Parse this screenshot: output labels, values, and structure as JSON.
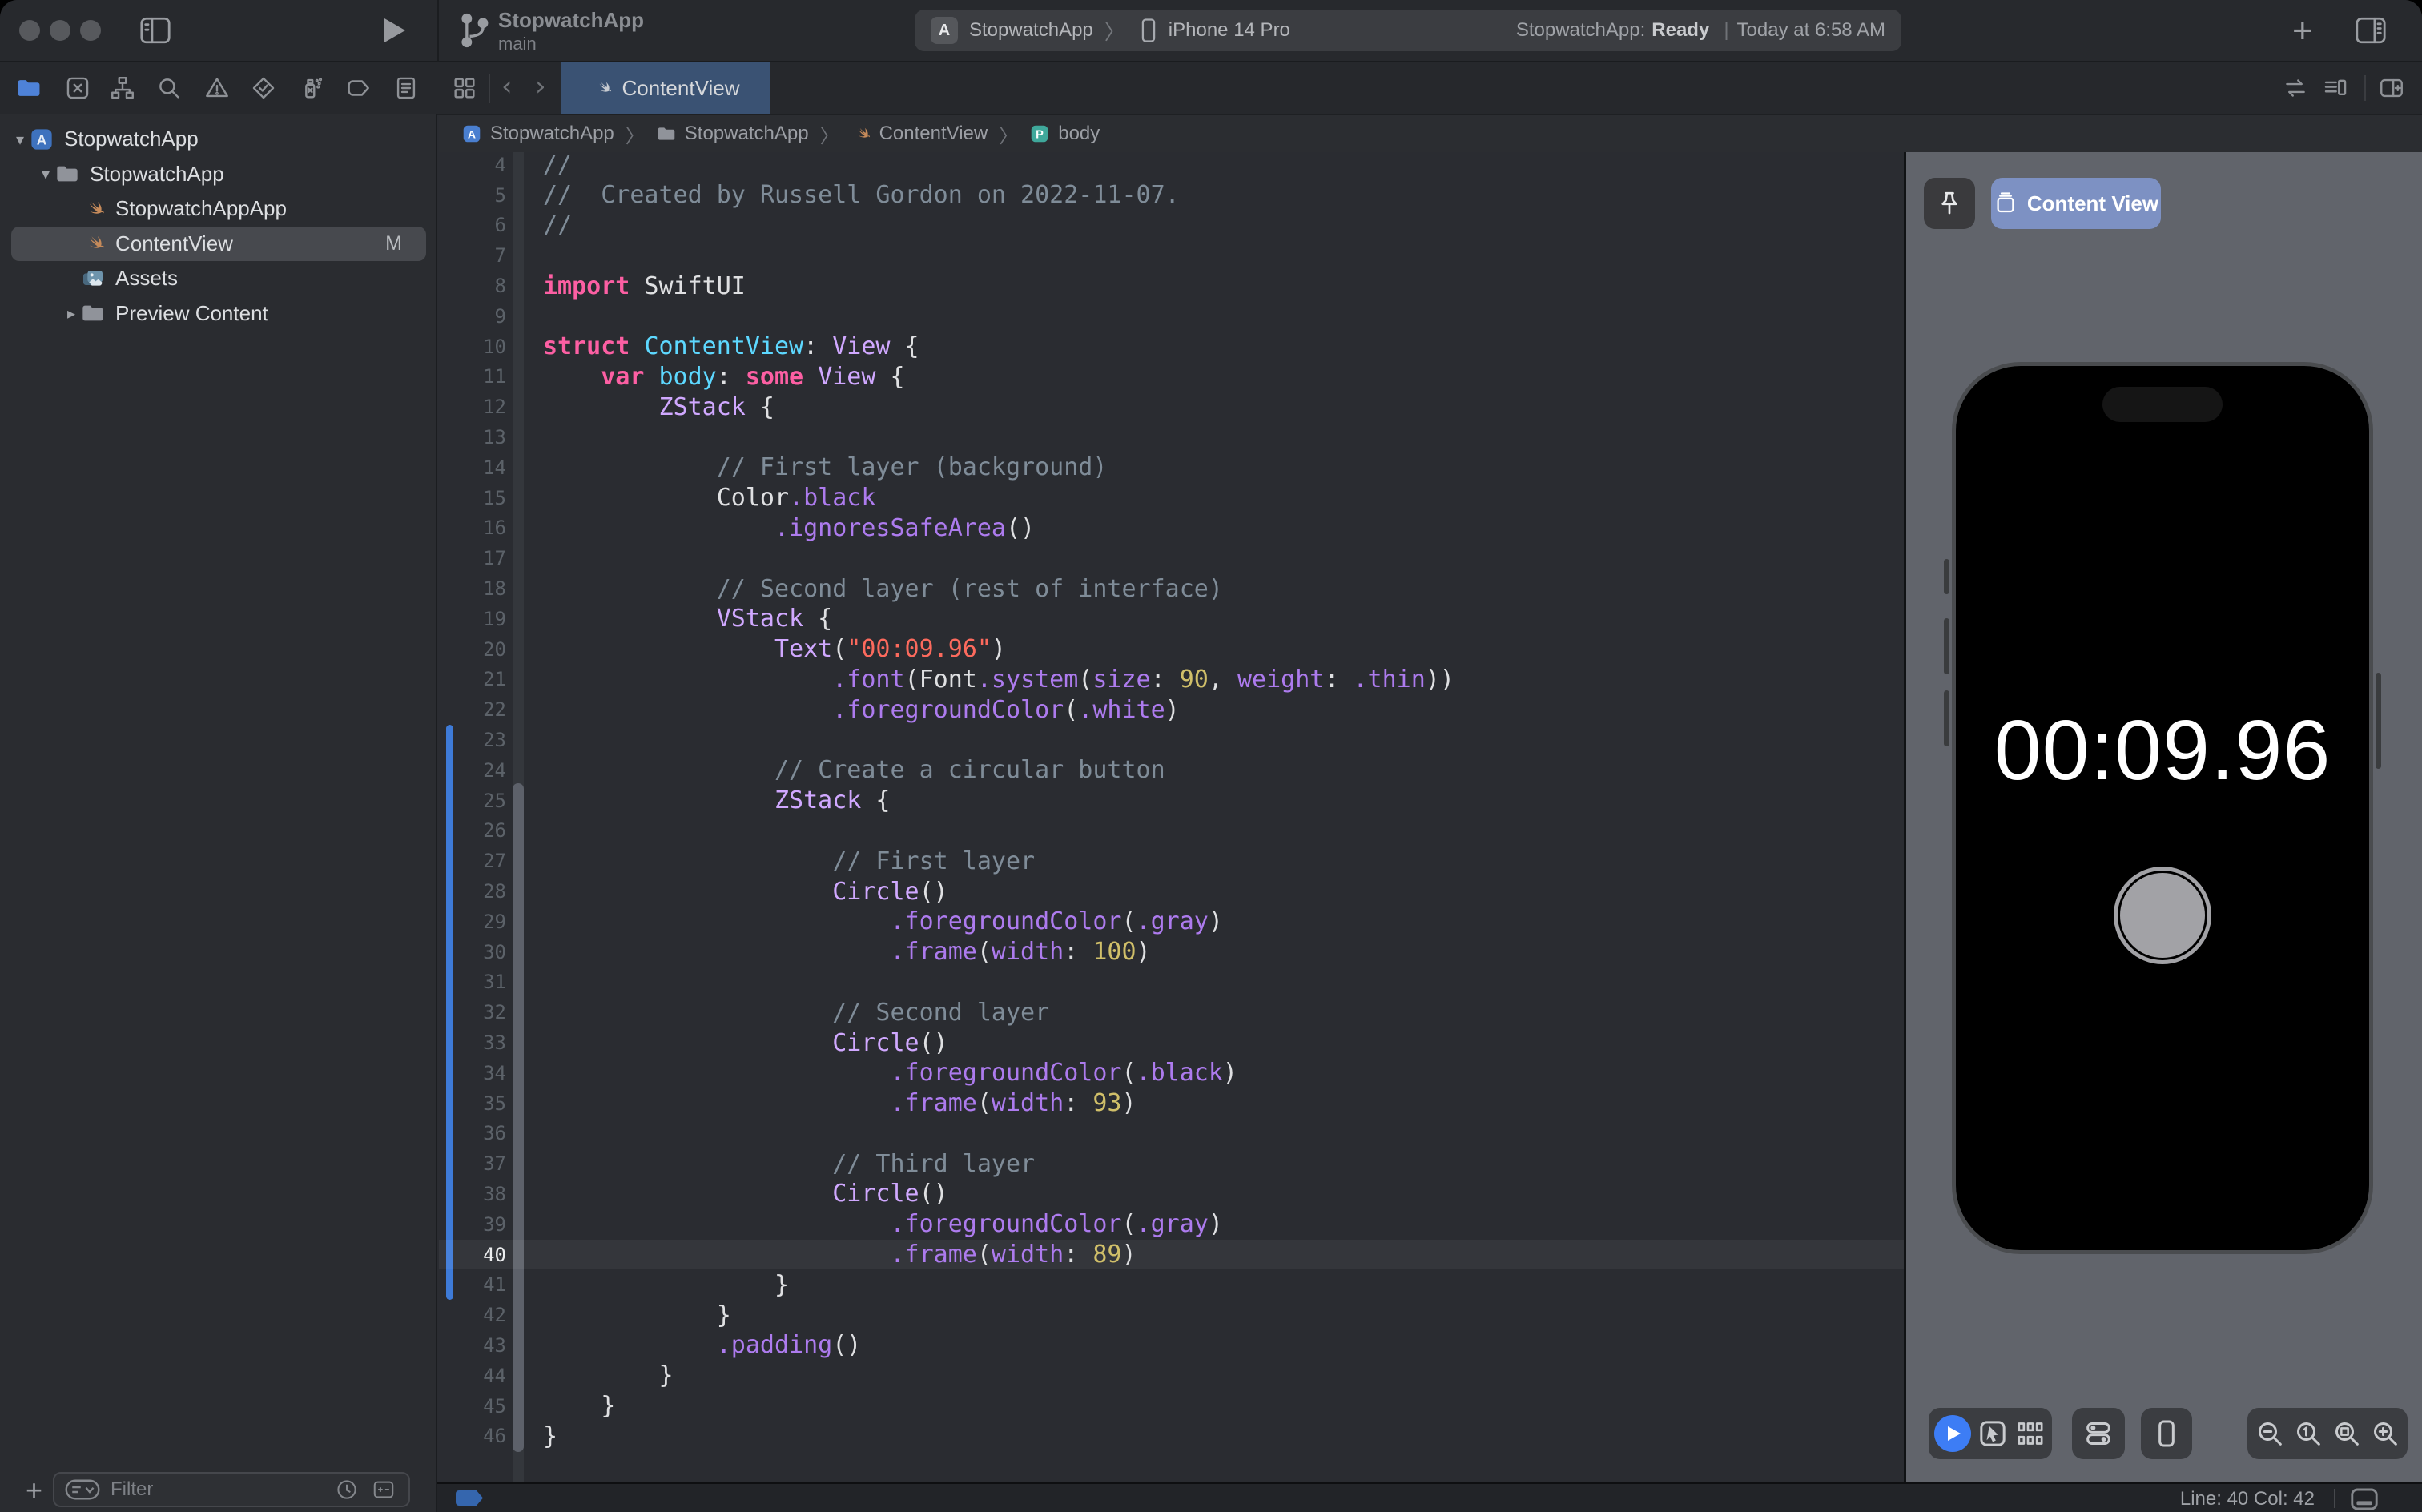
{
  "toolbar": {
    "project_name": "StopwatchApp",
    "branch_name": "main",
    "scheme_app": "StopwatchApp",
    "scheme_destination": "iPhone 14 Pro",
    "status_app": "StopwatchApp:",
    "status_state": "Ready",
    "status_divider": "|",
    "status_time": "Today at 6:58 AM"
  },
  "navigator": {
    "tabs": [
      "project",
      "source-control",
      "symbols",
      "find",
      "issues",
      "tests",
      "debug",
      "breakpoints",
      "reports"
    ],
    "files": [
      {
        "label": "StopwatchApp",
        "icon": "project",
        "depth": 0,
        "disclosure": "open"
      },
      {
        "label": "StopwatchApp",
        "icon": "folder",
        "depth": 1,
        "disclosure": "open"
      },
      {
        "label": "StopwatchAppApp",
        "icon": "swift",
        "depth": 2
      },
      {
        "label": "ContentView",
        "icon": "swift",
        "depth": 2,
        "selected": true,
        "badge": "M"
      },
      {
        "label": "Assets",
        "icon": "assets",
        "depth": 2
      },
      {
        "label": "Preview Content",
        "icon": "folder",
        "depth": 2,
        "disclosure": "closed"
      }
    ],
    "filter_placeholder": "Filter"
  },
  "editor": {
    "tab_label": "ContentView",
    "breadcrumbs": [
      {
        "label": "StopwatchApp",
        "icon": "app"
      },
      {
        "label": "StopwatchApp",
        "icon": "folder"
      },
      {
        "label": "ContentView",
        "icon": "swift"
      },
      {
        "label": "body",
        "icon": "property"
      }
    ],
    "lines": [
      {
        "n": 4,
        "t": [
          [
            "c",
            "//"
          ]
        ]
      },
      {
        "n": 5,
        "t": [
          [
            "c",
            "//  Created by Russell Gordon on 2022-11-07."
          ]
        ]
      },
      {
        "n": 6,
        "t": [
          [
            "c",
            "//"
          ]
        ]
      },
      {
        "n": 7,
        "t": []
      },
      {
        "n": 8,
        "t": [
          [
            "k",
            "import"
          ],
          [
            "p",
            " SwiftUI"
          ]
        ]
      },
      {
        "n": 9,
        "t": []
      },
      {
        "n": 10,
        "t": [
          [
            "k",
            "struct"
          ],
          [
            "p",
            " "
          ],
          [
            "d",
            "ContentView"
          ],
          [
            "p",
            ": "
          ],
          [
            "t",
            "View"
          ],
          [
            "p",
            " {"
          ]
        ]
      },
      {
        "n": 11,
        "t": [
          [
            "p",
            "    "
          ],
          [
            "k",
            "var"
          ],
          [
            "p",
            " "
          ],
          [
            "d",
            "body"
          ],
          [
            "p",
            ": "
          ],
          [
            "k",
            "some"
          ],
          [
            "p",
            " "
          ],
          [
            "t",
            "View"
          ],
          [
            "p",
            " {"
          ]
        ]
      },
      {
        "n": 12,
        "t": [
          [
            "p",
            "        "
          ],
          [
            "t",
            "ZStack"
          ],
          [
            "p",
            " {"
          ]
        ]
      },
      {
        "n": 13,
        "t": []
      },
      {
        "n": 14,
        "t": [
          [
            "c",
            "            // First layer (background)"
          ]
        ]
      },
      {
        "n": 15,
        "t": [
          [
            "p",
            "            Color"
          ],
          [
            "m",
            ".black"
          ]
        ]
      },
      {
        "n": 16,
        "t": [
          [
            "p",
            "                "
          ],
          [
            "m",
            ".ignoresSafeArea"
          ],
          [
            "p",
            "()"
          ]
        ]
      },
      {
        "n": 17,
        "t": []
      },
      {
        "n": 18,
        "t": [
          [
            "c",
            "            // Second layer (rest of interface)"
          ]
        ]
      },
      {
        "n": 19,
        "t": [
          [
            "p",
            "            "
          ],
          [
            "t",
            "VStack"
          ],
          [
            "p",
            " {"
          ]
        ]
      },
      {
        "n": 20,
        "t": [
          [
            "p",
            "                "
          ],
          [
            "t",
            "Text"
          ],
          [
            "p",
            "("
          ],
          [
            "s",
            "\"00:09.96\""
          ],
          [
            "p",
            ")"
          ]
        ]
      },
      {
        "n": 21,
        "t": [
          [
            "p",
            "                    "
          ],
          [
            "m",
            ".font"
          ],
          [
            "p",
            "(Font"
          ],
          [
            "m",
            ".system"
          ],
          [
            "p",
            "("
          ],
          [
            "m",
            "size"
          ],
          [
            "p",
            ": "
          ],
          [
            "n",
            "90"
          ],
          [
            "p",
            ", "
          ],
          [
            "m",
            "weight"
          ],
          [
            "p",
            ": "
          ],
          [
            "m",
            ".thin"
          ],
          [
            "p",
            "))"
          ]
        ]
      },
      {
        "n": 22,
        "t": [
          [
            "p",
            "                    "
          ],
          [
            "m",
            ".foregroundColor"
          ],
          [
            "p",
            "("
          ],
          [
            "m",
            ".white"
          ],
          [
            "p",
            ")"
          ]
        ]
      },
      {
        "n": 23,
        "t": []
      },
      {
        "n": 24,
        "t": [
          [
            "c",
            "                // Create a circular button"
          ]
        ]
      },
      {
        "n": 25,
        "t": [
          [
            "p",
            "                "
          ],
          [
            "t",
            "ZStack"
          ],
          [
            "p",
            " {"
          ]
        ]
      },
      {
        "n": 26,
        "t": []
      },
      {
        "n": 27,
        "t": [
          [
            "c",
            "                    // First layer"
          ]
        ]
      },
      {
        "n": 28,
        "t": [
          [
            "p",
            "                    "
          ],
          [
            "t",
            "Circle"
          ],
          [
            "p",
            "()"
          ]
        ]
      },
      {
        "n": 29,
        "t": [
          [
            "p",
            "                        "
          ],
          [
            "m",
            ".foregroundColor"
          ],
          [
            "p",
            "("
          ],
          [
            "m",
            ".gray"
          ],
          [
            "p",
            ")"
          ]
        ]
      },
      {
        "n": 30,
        "t": [
          [
            "p",
            "                        "
          ],
          [
            "m",
            ".frame"
          ],
          [
            "p",
            "("
          ],
          [
            "m",
            "width"
          ],
          [
            "p",
            ": "
          ],
          [
            "n",
            "100"
          ],
          [
            "p",
            ")"
          ]
        ]
      },
      {
        "n": 31,
        "t": []
      },
      {
        "n": 32,
        "t": [
          [
            "c",
            "                    // Second layer"
          ]
        ]
      },
      {
        "n": 33,
        "t": [
          [
            "p",
            "                    "
          ],
          [
            "t",
            "Circle"
          ],
          [
            "p",
            "()"
          ]
        ]
      },
      {
        "n": 34,
        "t": [
          [
            "p",
            "                        "
          ],
          [
            "m",
            ".foregroundColor"
          ],
          [
            "p",
            "("
          ],
          [
            "m",
            ".black"
          ],
          [
            "p",
            ")"
          ]
        ]
      },
      {
        "n": 35,
        "t": [
          [
            "p",
            "                        "
          ],
          [
            "m",
            ".frame"
          ],
          [
            "p",
            "("
          ],
          [
            "m",
            "width"
          ],
          [
            "p",
            ": "
          ],
          [
            "n",
            "93"
          ],
          [
            "p",
            ")"
          ]
        ]
      },
      {
        "n": 36,
        "t": []
      },
      {
        "n": 37,
        "t": [
          [
            "c",
            "                    // Third layer"
          ]
        ]
      },
      {
        "n": 38,
        "t": [
          [
            "p",
            "                    "
          ],
          [
            "t",
            "Circle"
          ],
          [
            "p",
            "()"
          ]
        ]
      },
      {
        "n": 39,
        "t": [
          [
            "p",
            "                        "
          ],
          [
            "m",
            ".foregroundColor"
          ],
          [
            "p",
            "("
          ],
          [
            "m",
            ".gray"
          ],
          [
            "p",
            ")"
          ]
        ]
      },
      {
        "n": 40,
        "t": [
          [
            "p",
            "                        "
          ],
          [
            "m",
            ".frame"
          ],
          [
            "p",
            "("
          ],
          [
            "m",
            "width"
          ],
          [
            "p",
            ": "
          ],
          [
            "n",
            "89"
          ],
          [
            "p",
            ")"
          ]
        ],
        "hl": true
      },
      {
        "n": 41,
        "t": [
          [
            "p",
            "                }"
          ]
        ]
      },
      {
        "n": 42,
        "t": [
          [
            "p",
            "            }"
          ]
        ]
      },
      {
        "n": 43,
        "t": [
          [
            "p",
            "            "
          ],
          [
            "m",
            ".padding"
          ],
          [
            "p",
            "()"
          ]
        ]
      },
      {
        "n": 44,
        "t": [
          [
            "p",
            "        }"
          ]
        ]
      },
      {
        "n": 45,
        "t": [
          [
            "p",
            "    }"
          ]
        ]
      },
      {
        "n": 46,
        "t": [
          [
            "p",
            "}"
          ]
        ]
      }
    ]
  },
  "preview": {
    "canvas_button": "Content View",
    "screen_time": "00:09.96",
    "toolbar_icons": [
      "live-preview-play",
      "selectable-mode",
      "variants-mode",
      "device-settings",
      "device-bezels",
      "zoom-out",
      "zoom-100",
      "zoom-fit",
      "zoom-in"
    ]
  },
  "status_bar": {
    "line_col": "Line: 40  Col: 42"
  },
  "colors": {
    "accent_blue": "#3D7DF5",
    "change_bar_blue": "#3E7BD8",
    "keyword_pink": "#FC5FA3",
    "string_red": "#FC6A5D",
    "number_yellow": "#D0BF69",
    "type_purple": "#D0A8FF",
    "member_purple": "#AD7BEE",
    "declaration_cyan": "#5DD8FF",
    "comment_gray": "#7F8C98",
    "selected_tab": "#3A5273",
    "preview_background": "#61646B",
    "content_view_button": "#7D91C3"
  }
}
